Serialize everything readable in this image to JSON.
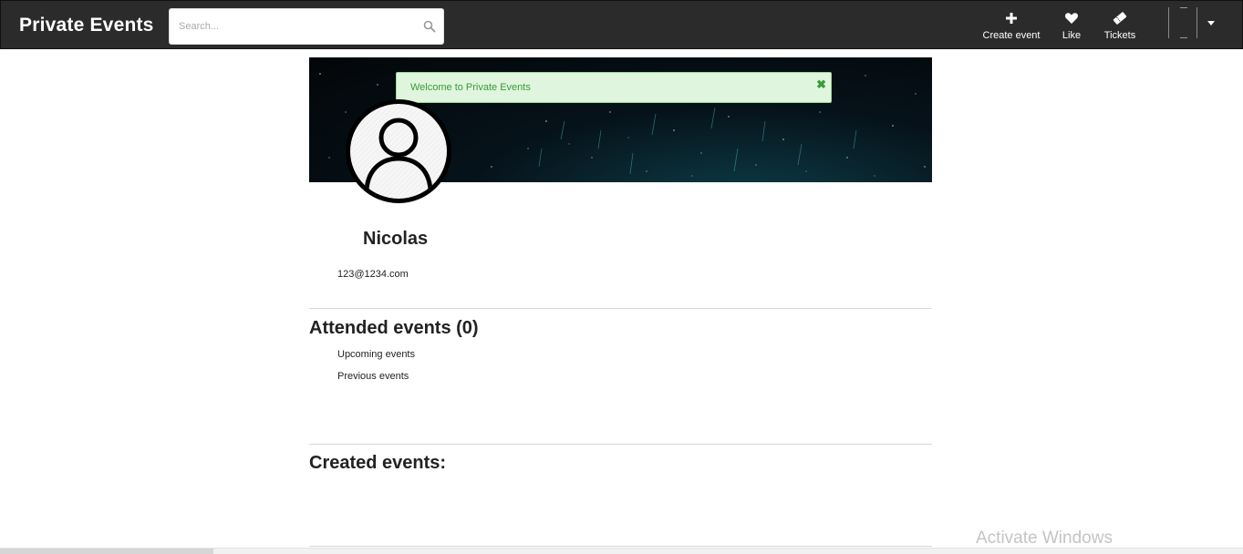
{
  "navbar": {
    "brand": "Private Events",
    "search": {
      "placeholder": "Search...",
      "value": ""
    },
    "items": [
      {
        "label": "Create event",
        "icon": "plus-icon"
      },
      {
        "label": "Like",
        "icon": "heart-icon"
      },
      {
        "label": "Tickets",
        "icon": "ticket-icon"
      }
    ],
    "user_menu_icon": "chevron-down-icon"
  },
  "alert": {
    "message": "Welcome to Private Events",
    "close_symbol": "✖",
    "color": "#3a9a3a",
    "background": "#dff5dd"
  },
  "profile": {
    "name": "Nicolas",
    "email": "123@1234.com",
    "avatar_icon": "user-avatar-icon"
  },
  "attended": {
    "title": "Attended events (0)",
    "links": [
      "Upcoming events",
      "Previous events"
    ]
  },
  "created": {
    "title": "Created events:"
  },
  "watermark": "Activate Windows",
  "colors": {
    "navbar": "#2b2b2b",
    "navbar_text": "#ffffff"
  }
}
